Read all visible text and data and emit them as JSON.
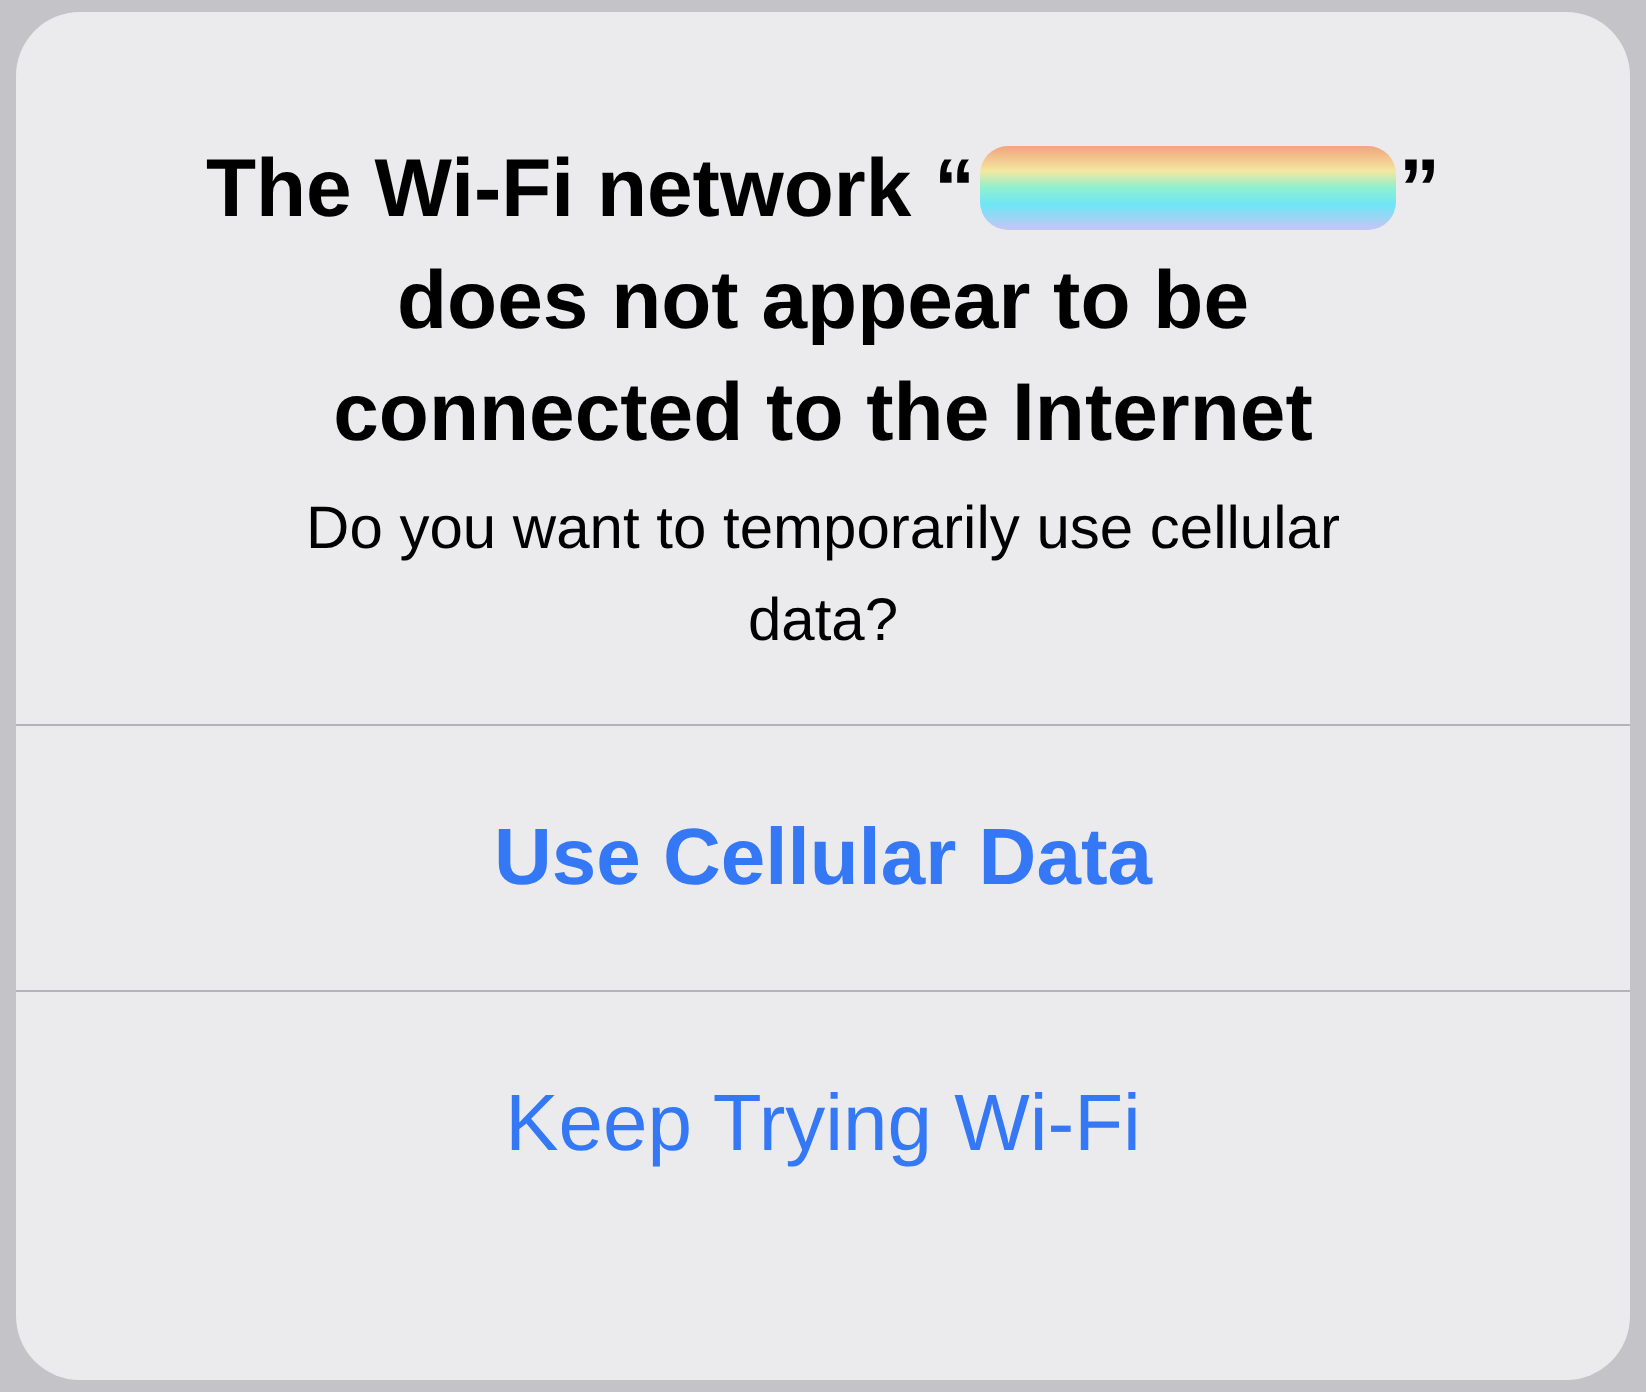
{
  "alert": {
    "title_start": "The Wi-Fi network “",
    "title_end": "”",
    "title_rest": "does not appear to be connected to the Internet",
    "message": "Do you want to temporarily use cellular data?",
    "buttons": [
      {
        "label": "Use Cellular Data",
        "kind": "preferred"
      },
      {
        "label": "Keep Trying Wi-Fi",
        "kind": "normal"
      }
    ]
  }
}
